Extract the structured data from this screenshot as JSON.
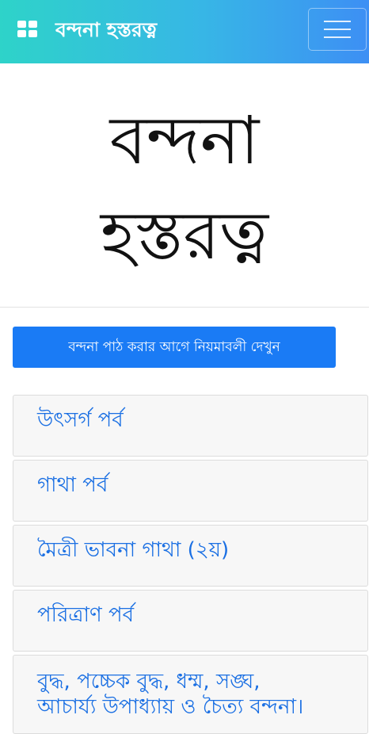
{
  "navbar": {
    "brand_icon": "grid-icon",
    "title": "বন্দনা হস্তরত্ন",
    "menu_icon": "hamburger-menu-icon"
  },
  "hero": {
    "line1": "বন্দনা",
    "line2": "হস্তরত্ন"
  },
  "rules_button": "বন্দনা পাঠ করার আগে নিয়মাবলী দেখুন",
  "sections": [
    "উৎসর্গ পর্ব",
    "গাথা পর্ব",
    "মৈত্রী ভাবনা গাথা (২য়)",
    "পরিত্রাণ পর্ব"
  ],
  "last_section": {
    "line1": "বুদ্ধ, পচ্চেক বুদ্ধ, ধম্ম, সঙ্ঘ,",
    "line2": "আচার্য্য উপাধ্যায় ও চৈত্য বন্দনা।"
  },
  "colors": {
    "accent": "#1a7bf5",
    "link": "#1a6fe3",
    "nav_gradient_start": "#2ed3c9",
    "nav_gradient_end": "#3d8ff4"
  }
}
